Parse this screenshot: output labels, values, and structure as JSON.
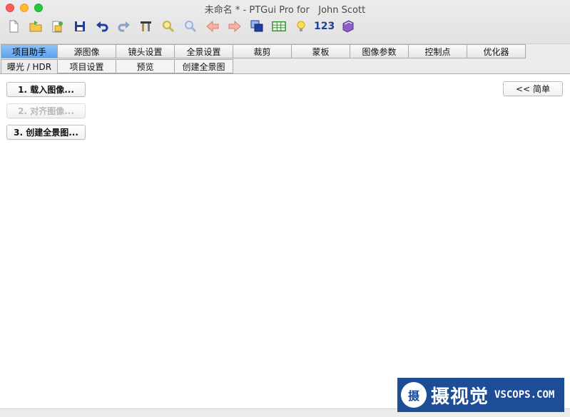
{
  "window": {
    "title": "未命名 * - PTGui Pro for",
    "user": "John Scott"
  },
  "toolbar": {
    "icons": [
      "new-file-icon",
      "open-folder-icon",
      "open-recent-icon",
      "save-icon",
      "undo-icon",
      "redo-icon",
      "tools-icon",
      "zoom-in-icon",
      "zoom-out-icon",
      "back-arrow-icon",
      "forward-arrow-icon",
      "panorama-editor-icon",
      "table-icon",
      "lightbulb-icon",
      "numbers-icon",
      "help-book-icon"
    ],
    "numbers_label": "123"
  },
  "tabs_row1": [
    {
      "label": "项目助手",
      "active": true
    },
    {
      "label": "源图像"
    },
    {
      "label": "镜头设置"
    },
    {
      "label": "全景设置"
    },
    {
      "label": "裁剪"
    },
    {
      "label": "蒙板"
    },
    {
      "label": "图像参数"
    },
    {
      "label": "控制点"
    },
    {
      "label": "优化器"
    }
  ],
  "tabs_row2": [
    {
      "label": "曝光 / HDR"
    },
    {
      "label": "项目设置"
    },
    {
      "label": "预览"
    },
    {
      "label": "创建全景图"
    }
  ],
  "assistant": {
    "load_images": "1. 载入图像...",
    "align_images": "2. 对齐图像...",
    "create_panorama": "3. 创建全景图...",
    "simple_mode": "<< 简单"
  },
  "watermark": {
    "logo_char": "摄",
    "cn_text": "摄视觉",
    "en_text": "VSCOPS.COM"
  },
  "colors": {
    "active_tab": "#5ca1ee",
    "watermark_bg": "#1e4d98"
  }
}
